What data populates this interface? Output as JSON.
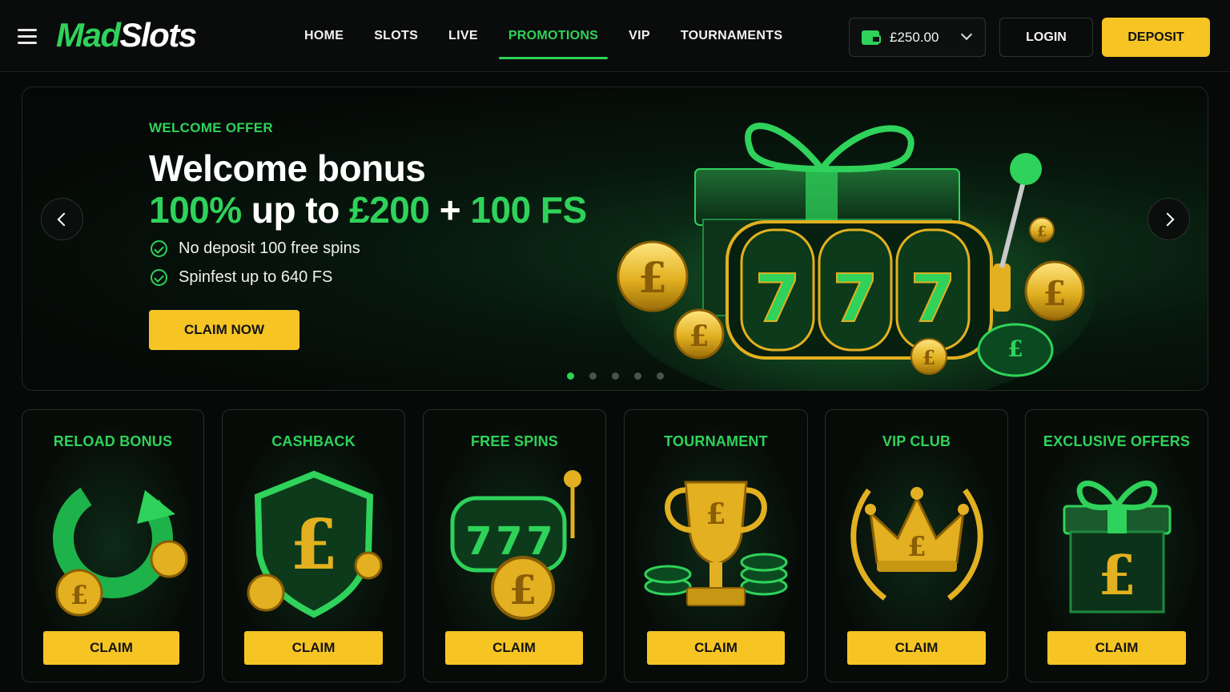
{
  "header": {
    "logo": {
      "part1": "Mad",
      "part2": "Slots"
    },
    "nav": [
      "HOME",
      "SLOTS",
      "LIVE",
      "PROMOTIONS",
      "VIP",
      "TOURNAMENTS"
    ],
    "active_nav": "PROMOTIONS",
    "balance": "£250.00",
    "login_label": "LOGIN",
    "deposit_label": "DEPOSIT"
  },
  "hero": {
    "eyebrow": "WELCOME OFFER",
    "title": "Welcome bonus",
    "subtitle_parts": [
      "100%",
      " up to ",
      "£200",
      " + ",
      "100 FS"
    ],
    "features": [
      "No deposit 100 free spins",
      "Spinfest up to 640 FS"
    ],
    "cta_label": "CLAIM NOW",
    "slide_count": 5,
    "active_slide": 1
  },
  "promos": [
    {
      "title": "RELOAD BONUS",
      "button": "CLAIM",
      "icon": "reload-icon"
    },
    {
      "title": "CASHBACK",
      "button": "CLAIM",
      "icon": "shield-icon"
    },
    {
      "title": "FREE SPINS",
      "button": "CLAIM",
      "icon": "slot-machine-icon"
    },
    {
      "title": "TOURNAMENT",
      "button": "CLAIM",
      "icon": "trophy-icon"
    },
    {
      "title": "VIP CLUB",
      "button": "CLAIM",
      "icon": "crown-icon"
    },
    {
      "title": "EXCLUSIVE OFFERS",
      "button": "CLAIM",
      "icon": "gift-icon"
    }
  ],
  "colors": {
    "accent": "#2fd25a",
    "cta": "#f6c524",
    "background": "#070908",
    "gold": "#e8b923"
  }
}
